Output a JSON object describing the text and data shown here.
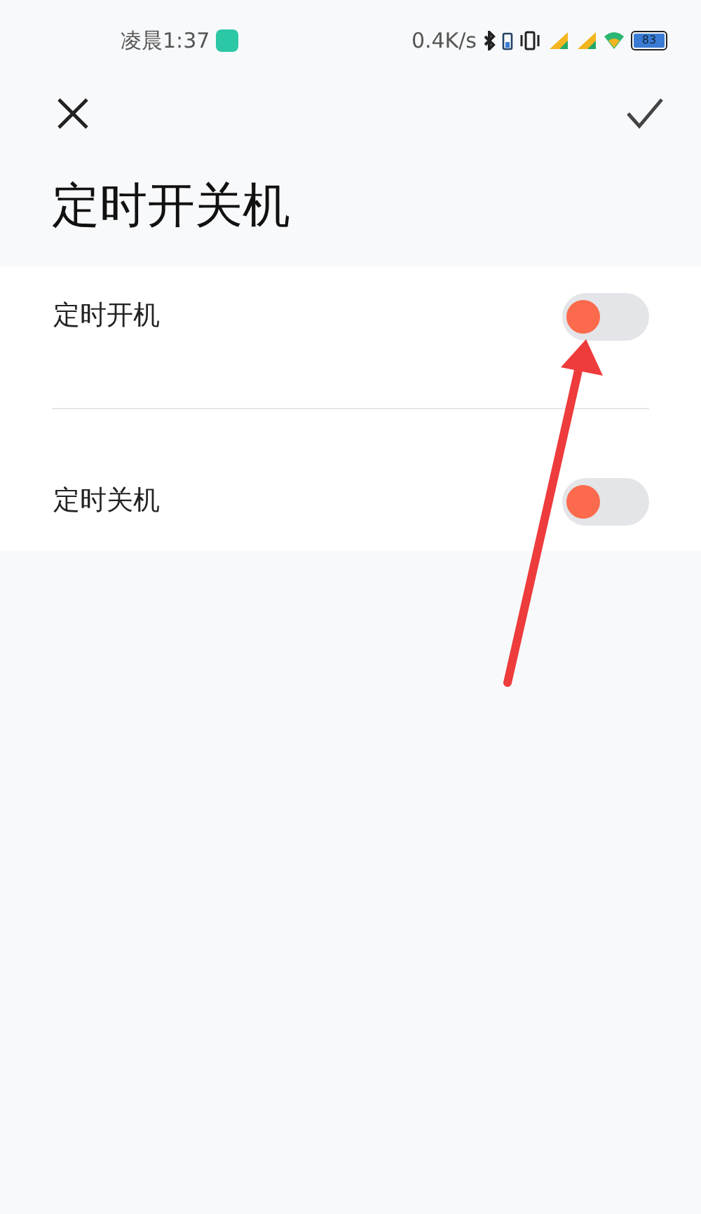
{
  "status_bar": {
    "time": "凌晨1:37",
    "speed": "0.4K/s",
    "battery": "83"
  },
  "title": "定时开关机",
  "items": [
    {
      "label": "定时开机",
      "on": false
    },
    {
      "label": "定时关机",
      "on": false
    }
  ]
}
